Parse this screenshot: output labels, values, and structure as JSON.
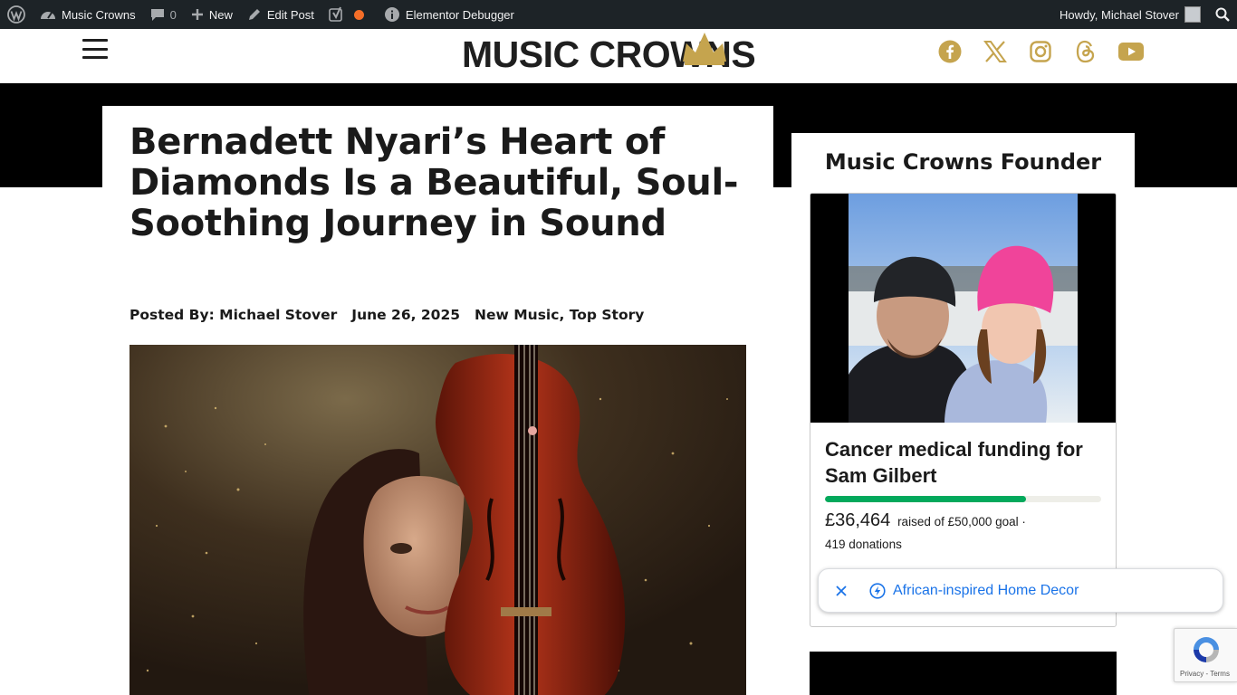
{
  "admin_bar": {
    "site_name": "Music Crowns",
    "comments_count": "0",
    "new_label": "New",
    "edit_post_label": "Edit Post",
    "debugger_label": "Elementor Debugger",
    "greeting": "Howdy, Michael Stover"
  },
  "header": {
    "logo_text": "MUSIC CROWNS",
    "social_icons": [
      "facebook-icon",
      "x-icon",
      "instagram-icon",
      "threads-icon",
      "youtube-icon"
    ],
    "accent_color": "#c5a44e"
  },
  "article": {
    "title": "Bernadett Nyari’s Heart of Diamonds Is a Beautiful, Soul-Soothing Journey in Sound",
    "author_line": "Posted By: Michael Stover",
    "date": "June 26, 2025",
    "category_1": "New Music",
    "category_sep": ", ",
    "category_2": "Top Story"
  },
  "sidebar": {
    "heading": "Music Crowns Founder",
    "fundraiser": {
      "title": "Cancer medical funding for Sam Gilbert",
      "amount": "£36,464",
      "raised_text": "raised of £50,000 goal ·",
      "donations": "419 donations",
      "progress_fraction": 0.729
    }
  },
  "ad": {
    "text": "African-inspired Home Decor"
  },
  "recaptcha": {
    "terms": "Privacy - Terms"
  }
}
